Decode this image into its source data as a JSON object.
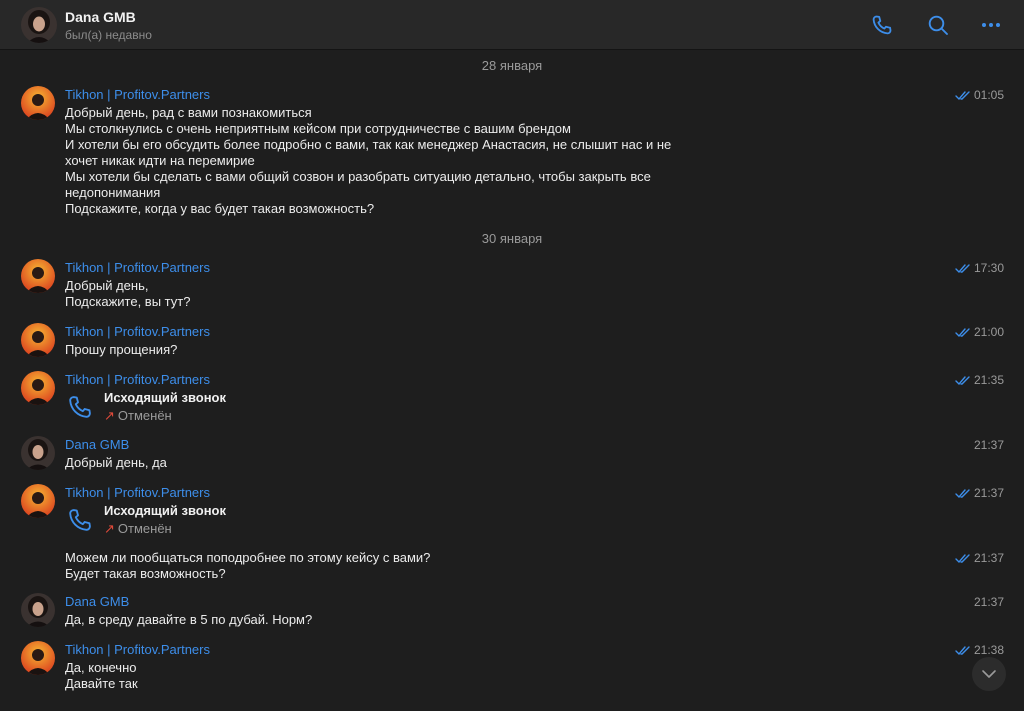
{
  "header": {
    "title": "Dana GMB",
    "status": "был(а) недавно",
    "icons": [
      "phone-icon",
      "search-icon",
      "more-icon"
    ]
  },
  "colors": {
    "accent": "#3d8eea",
    "background": "#1e1e1e",
    "header": "#282828",
    "declined": "#e04a3a"
  },
  "dates": [
    "28 января",
    "30 января"
  ],
  "messages": [
    {
      "sender": "Tikhon | Profitov.Partners",
      "time": "01:05",
      "read": true,
      "lines": [
        "Добрый день, рад с вами познакомиться",
        "Мы столкнулись с очень неприятным кейсом при сотрудничестве с вашим брендом",
        "И хотели бы его обсудить более подробно с вами, так как менеджер Анастасия, не слышит нас и не",
        "хочет никак идти на перемирие",
        "Мы хотели бы сделать с вами общий созвон и разобрать ситуацию детально, чтобы закрыть все",
        "недопонимания",
        "Подскажите, когда у вас будет такая возможность?"
      ]
    },
    {
      "sender": "Tikhon | Profitov.Partners",
      "time": "17:30",
      "read": true,
      "lines": [
        "Добрый день,",
        "Подскажите, вы тут?"
      ]
    },
    {
      "sender": "Tikhon | Profitov.Partners",
      "time": "21:00",
      "read": true,
      "lines": [
        "Прошу прощения?"
      ]
    },
    {
      "sender": "Tikhon | Profitov.Partners",
      "time": "21:35",
      "read": true,
      "call": {
        "title": "Исходящий звонок",
        "status": "Отменён"
      }
    },
    {
      "sender": "Dana GMB",
      "time": "21:37",
      "read": false,
      "lines": [
        "Добрый день, да"
      ]
    },
    {
      "sender": "Tikhon | Profitov.Partners",
      "time": "21:37",
      "read": true,
      "call": {
        "title": "Исходящий звонок",
        "status": "Отменён"
      }
    },
    {
      "sender": "",
      "time": "21:37",
      "read": true,
      "lines": [
        "Можем ли пообщаться поподробнее по этому кейсу с вами?",
        "Будет такая возможность?"
      ]
    },
    {
      "sender": "Dana GMB",
      "time": "21:37",
      "read": false,
      "lines": [
        "Да, в среду давайте в 5 по дубай. Норм?"
      ]
    },
    {
      "sender": "Tikhon | Profitov.Partners",
      "time": "21:38",
      "read": true,
      "lines": [
        "Да, конечно",
        "Давайте так"
      ]
    }
  ]
}
